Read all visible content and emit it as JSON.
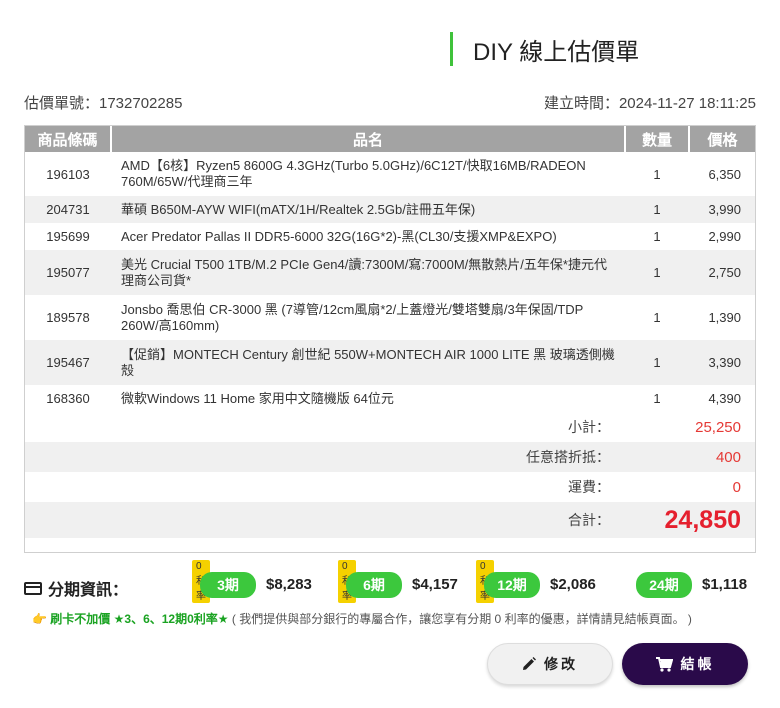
{
  "header": {
    "title": "DIY 線上估價單"
  },
  "meta": {
    "quote_no": "估價單號：1732702285",
    "created": "建立時間：2024-11-27 18:11:25"
  },
  "table": {
    "columns": [
      "商品條碼",
      "品名",
      "數量",
      "價格"
    ],
    "rows": [
      {
        "code": "196103",
        "name": "AMD【6核】Ryzen5 8600G 4.3GHz(Turbo 5.0GHz)/6C12T/快取16MB/RADEON 760M/65W/代理商三年",
        "qty": "1",
        "price": "6,350"
      },
      {
        "code": "204731",
        "name": "華碩 B650M-AYW WIFI(mATX/1H/Realtek 2.5Gb/註冊五年保)",
        "qty": "1",
        "price": "3,990"
      },
      {
        "code": "195699",
        "name": "Acer Predator Pallas II DDR5-6000 32G(16G*2)-黑(CL30/支援XMP&EXPO)",
        "qty": "1",
        "price": "2,990"
      },
      {
        "code": "195077",
        "name": "美光 Crucial T500 1TB/M.2 PCIe Gen4/讀:7300M/寫:7000M/無散熱片/五年保*捷元代理商公司貨*",
        "qty": "1",
        "price": "2,750"
      },
      {
        "code": "189578",
        "name": "Jonsbo 喬思伯 CR-3000 黑 (7導管/12cm風扇*2/上蓋燈光/雙塔雙扇/3年保固/TDP 260W/高160mm)",
        "qty": "1",
        "price": "1,390"
      },
      {
        "code": "195467",
        "name": "【促銷】MONTECH Century 創世紀 550W+MONTECH AIR 1000 LITE 黑 玻璃透側機殼",
        "qty": "1",
        "price": "3,390"
      },
      {
        "code": "168360",
        "name": "微軟Windows 11 Home 家用中文隨機版 64位元",
        "qty": "1",
        "price": "4,390"
      }
    ]
  },
  "summary": {
    "subtotal_label": "小計：",
    "subtotal": "25,250",
    "discount_label": "任意搭折抵：",
    "discount": "400",
    "shipping_label": "運費：",
    "shipping": "0",
    "total_label": "合計：",
    "total": "24,850"
  },
  "installments": {
    "title": "分期資訊：",
    "items": [
      {
        "badge": "0利率",
        "period": "3期",
        "amount": "$8,283"
      },
      {
        "badge": "0利率",
        "period": "6期",
        "amount": "$4,157"
      },
      {
        "badge": "0利率",
        "period": "12期",
        "amount": "$2,086"
      },
      {
        "badge": "",
        "period": "24期",
        "amount": "$1,118"
      }
    ]
  },
  "note": {
    "icon": "👉",
    "part1": "刷卡不加價",
    "part2": "★3、6、12期0利率★",
    "part3": "( 我們提供與部分銀行的專屬合作，讓您享有分期 0 利率的優惠，詳情請見結帳頁面。 )"
  },
  "buttons": {
    "edit": "修改",
    "checkout": "結帳"
  },
  "colors": {
    "accent_green": "#3cc83d",
    "total_red": "#e5202e",
    "checkout_bg": "#2a0a4a",
    "badge_yellow": "#f5d100"
  }
}
